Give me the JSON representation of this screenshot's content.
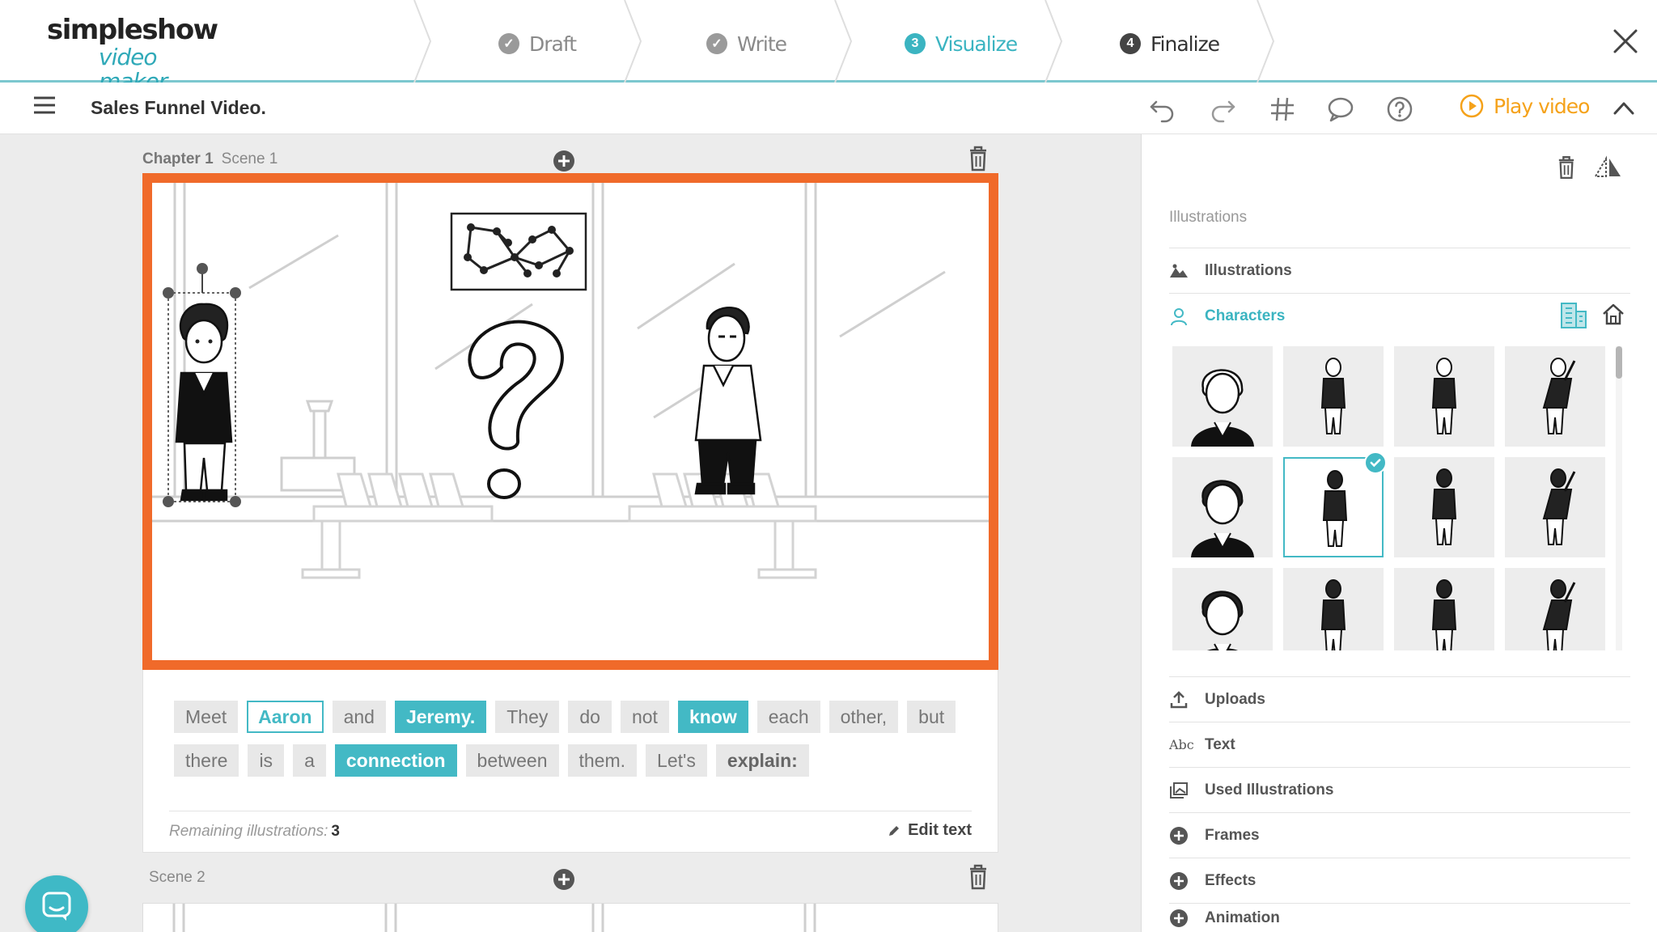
{
  "app": {
    "logo_line1": "simpleshow",
    "logo_line2": "video maker"
  },
  "steps": [
    {
      "num": "",
      "label": "Draft",
      "state": "done"
    },
    {
      "num": "",
      "label": "Write",
      "state": "done"
    },
    {
      "num": "3",
      "label": "Visualize",
      "state": "active"
    },
    {
      "num": "4",
      "label": "Finalize",
      "state": "todo"
    }
  ],
  "toolbar": {
    "title": "Sales Funnel Video.",
    "play_label": "Play video"
  },
  "scene1": {
    "chapter": "Chapter 1",
    "scene": "Scene 1",
    "words": [
      {
        "text": "Meet",
        "style": "plain"
      },
      {
        "text": "Aaron",
        "style": "outline"
      },
      {
        "text": "and",
        "style": "plain"
      },
      {
        "text": "Jeremy.",
        "style": "fill"
      },
      {
        "text": "They",
        "style": "plain"
      },
      {
        "text": "do",
        "style": "plain"
      },
      {
        "text": "not",
        "style": "plain"
      },
      {
        "text": "know",
        "style": "fill"
      },
      {
        "text": "each",
        "style": "plain"
      },
      {
        "text": "other,",
        "style": "plain"
      },
      {
        "text": "but",
        "style": "plain"
      },
      {
        "text": "there",
        "style": "plain"
      },
      {
        "text": "is",
        "style": "plain"
      },
      {
        "text": "a",
        "style": "plain"
      },
      {
        "text": "connection",
        "style": "fill"
      },
      {
        "text": "between",
        "style": "plain"
      },
      {
        "text": "them.",
        "style": "plain"
      },
      {
        "text": "Let's",
        "style": "plain"
      },
      {
        "text": "explain:",
        "style": "bold"
      }
    ],
    "remaining_label": "Remaining illustrations:",
    "remaining_count": "3",
    "edit_text_label": "Edit text"
  },
  "scene2": {
    "label": "Scene 2"
  },
  "right_panel": {
    "heading": "Illustrations",
    "sections": [
      {
        "label": "Illustrations",
        "icon": "mountain-icon"
      },
      {
        "label": "Characters",
        "icon": "person-icon"
      },
      {
        "label": "Uploads",
        "icon": "upload-icon"
      },
      {
        "label": "Text",
        "icon": "abc-icon"
      },
      {
        "label": "Used Illustrations",
        "icon": "gallery-icon"
      },
      {
        "label": "Frames",
        "icon": "plus-circle-icon"
      },
      {
        "label": "Effects",
        "icon": "plus-circle-icon"
      },
      {
        "label": "Animation",
        "icon": "plus-circle-icon"
      }
    ],
    "text_icon_label": "Abc",
    "selected_character_index": 5
  },
  "colors": {
    "accent": "#43b9c5",
    "frame": "#f06a2a",
    "play": "#f5a21a"
  }
}
